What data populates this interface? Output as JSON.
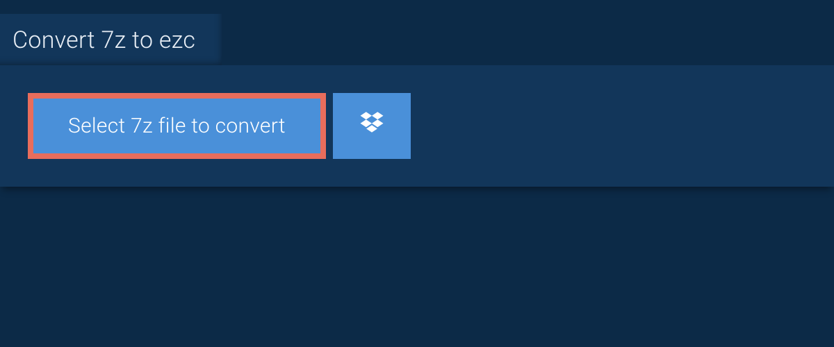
{
  "header": {
    "title": "Convert 7z to ezc"
  },
  "actions": {
    "select_file_label": "Select 7z file to convert",
    "dropbox_icon": "dropbox-icon"
  },
  "colors": {
    "background": "#0c2a47",
    "panel": "#12365a",
    "button": "#4a90d9",
    "highlight_border": "#e86d5c",
    "text": "#e8eef5"
  }
}
